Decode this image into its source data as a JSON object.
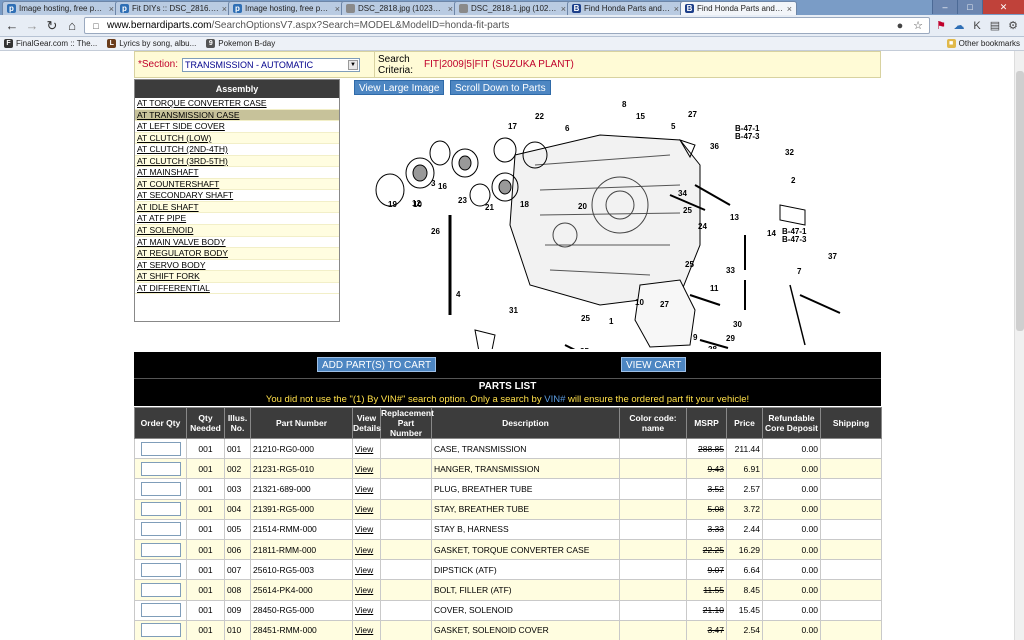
{
  "browser": {
    "tabs": [
      {
        "title": "Image hosting, free photo",
        "color": "#2f6fb5",
        "glyph": "p"
      },
      {
        "title": "Fit DIYs :: DSC_2816.jpg p",
        "color": "#2f6fb5",
        "glyph": "p"
      },
      {
        "title": "Image hosting, free photo",
        "color": "#2f6fb5",
        "glyph": "p"
      },
      {
        "title": "DSC_2818.jpg (1023×685)",
        "color": "#8a8a8a",
        "glyph": ""
      },
      {
        "title": "DSC_2818-1.jpg (1023×68",
        "color": "#8a8a8a",
        "glyph": ""
      },
      {
        "title": "Find Honda Parts and Hon",
        "color": "#1d3f8a",
        "glyph": "B"
      },
      {
        "title": "Find Honda Parts and Hon",
        "color": "#1d3f8a",
        "glyph": "B",
        "active": true
      }
    ],
    "url_domain": "www.bernardiparts.com",
    "url_path": "/SearchOptionsV7.aspx?Search=MODEL&ModelID=honda-fit-parts",
    "bookmarks": [
      {
        "label": "FinalGear.com :: The...",
        "color": "#333333"
      },
      {
        "label": "Lyrics by song, albu...",
        "color": "#6a3d1c"
      },
      {
        "label": "Pokemon B-day",
        "color": "#555555"
      }
    ],
    "other_bookmarks": "Other bookmarks"
  },
  "filter": {
    "section_label": "*Section:",
    "section_value": "TRANSMISSION - AUTOMATIC",
    "criteria_label": "Search Criteria:",
    "criteria_value": "FIT|2009|5|FIT (SUZUKA PLANT)"
  },
  "assembly": {
    "header": "Assembly",
    "items": [
      "AT TORQUE CONVERTER CASE",
      "AT TRANSMISSION CASE",
      "AT LEFT SIDE COVER",
      "AT CLUTCH (LOW)",
      "AT CLUTCH (2ND-4TH)",
      "AT CLUTCH (3RD-5TH)",
      "AT MAINSHAFT",
      "AT COUNTERSHAFT",
      "AT SECONDARY SHAFT",
      "AT IDLE SHAFT",
      "AT ATF PIPE",
      "AT SOLENOID",
      "AT MAIN VALVE BODY",
      "AT REGULATOR BODY",
      "AT SERVO BODY",
      "AT SHIFT FORK",
      "AT DIFFERENTIAL"
    ],
    "selected_index": 1
  },
  "diagram": {
    "view_large_label": "View Large Image",
    "scroll_down_label": "Scroll Down to Parts",
    "code": "TK64A0200A",
    "direction_label": "FR.",
    "callouts": [
      "19",
      "10",
      "16",
      "23",
      "17",
      "18",
      "21",
      "22",
      "6",
      "1",
      "8",
      "15",
      "27",
      "5",
      "36",
      "B-47-1",
      "B-47-3",
      "32",
      "2",
      "34",
      "13",
      "B-47-1",
      "B-47-3",
      "3",
      "12",
      "26",
      "25",
      "24",
      "14",
      "37",
      "20",
      "25",
      "33",
      "7",
      "11",
      "27",
      "4",
      "31",
      "25",
      "10",
      "30",
      "29",
      "9",
      "28",
      "35"
    ]
  },
  "cart": {
    "add_label": "ADD PART(S) TO CART",
    "view_label": "VIEW CART"
  },
  "parts": {
    "title": "PARTS LIST",
    "vin_warning_pre": "You did not use the \"(1) By VIN#\" search option. Only a search by ",
    "vin_warning_link": "VIN#",
    "vin_warning_post": " will ensure the ordered part fit your vehicle!",
    "columns": [
      "Order Qty",
      "Qty Needed",
      "Illus. No.",
      "Part Number",
      "View Details",
      "Replacement Part Number",
      "Description",
      "Color code: name",
      "MSRP",
      "Price",
      "Refundable Core Deposit",
      "Shipping"
    ],
    "view_label": "View",
    "rows": [
      {
        "qty": "001",
        "illus": "001",
        "part": "21210-RG0-000",
        "desc": "CASE, TRANSMISSION",
        "msrp": "288.85",
        "price": "211.44",
        "core": "0.00"
      },
      {
        "qty": "001",
        "illus": "002",
        "part": "21231-RG5-010",
        "desc": "HANGER, TRANSMISSION",
        "msrp": "9.43",
        "price": "6.91",
        "core": "0.00"
      },
      {
        "qty": "001",
        "illus": "003",
        "part": "21321-689-000",
        "desc": "PLUG, BREATHER TUBE",
        "msrp": "3.52",
        "price": "2.57",
        "core": "0.00"
      },
      {
        "qty": "001",
        "illus": "004",
        "part": "21391-RG5-000",
        "desc": "STAY, BREATHER TUBE",
        "msrp": "5.08",
        "price": "3.72",
        "core": "0.00"
      },
      {
        "qty": "001",
        "illus": "005",
        "part": "21514-RMM-000",
        "desc": "STAY B, HARNESS",
        "msrp": "3.33",
        "price": "2.44",
        "core": "0.00"
      },
      {
        "qty": "001",
        "illus": "006",
        "part": "21811-RMM-000",
        "desc": "GASKET, TORQUE CONVERTER CASE",
        "msrp": "22.25",
        "price": "16.29",
        "core": "0.00"
      },
      {
        "qty": "001",
        "illus": "007",
        "part": "25610-RG5-003",
        "desc": "DIPSTICK (ATF)",
        "msrp": "9.07",
        "price": "6.64",
        "core": "0.00"
      },
      {
        "qty": "001",
        "illus": "008",
        "part": "25614-PK4-000",
        "desc": "BOLT, FILLER (ATF)",
        "msrp": "11.55",
        "price": "8.45",
        "core": "0.00"
      },
      {
        "qty": "001",
        "illus": "009",
        "part": "28450-RG5-000",
        "desc": "COVER, SOLENOID",
        "msrp": "21.10",
        "price": "15.45",
        "core": "0.00"
      },
      {
        "qty": "001",
        "illus": "010",
        "part": "28451-RMM-000",
        "desc": "GASKET, SOLENOID COVER",
        "msrp": "3.47",
        "price": "2.54",
        "core": "0.00"
      }
    ]
  }
}
